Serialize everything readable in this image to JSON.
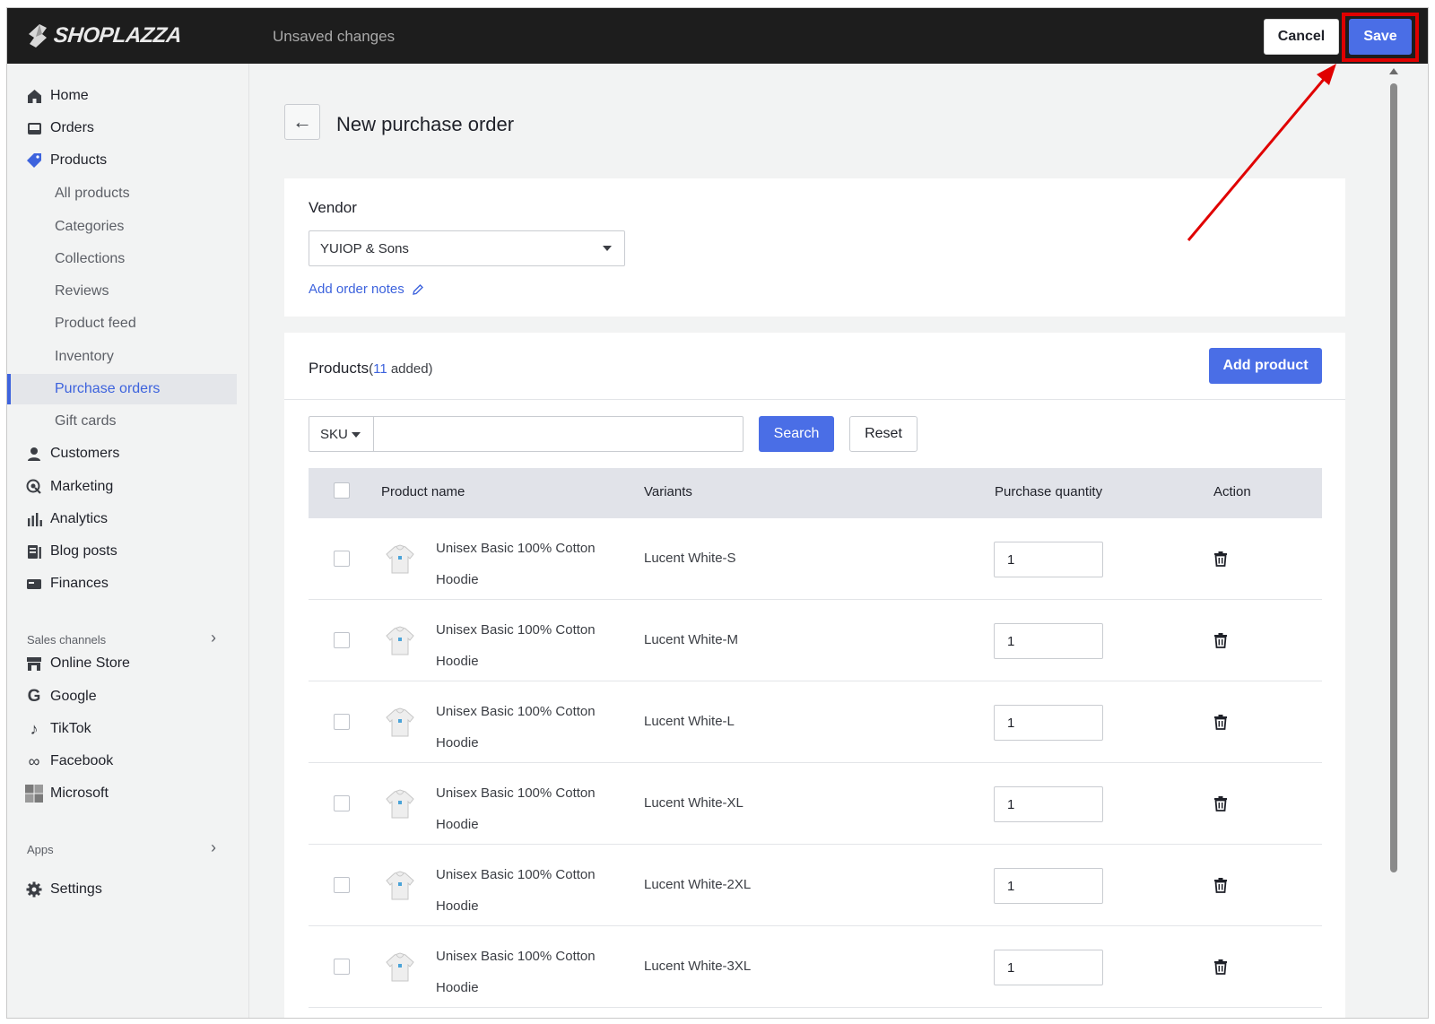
{
  "header": {
    "brand": "SHOPLAZZA",
    "status": "Unsaved changes",
    "cancel_label": "Cancel",
    "save_label": "Save",
    "highlight_color": "#e00000"
  },
  "sidebar": {
    "items": [
      {
        "label": "Home",
        "icon": "home-icon"
      },
      {
        "label": "Orders",
        "icon": "inbox-icon"
      },
      {
        "label": "Products",
        "icon": "tag-icon"
      }
    ],
    "product_subitems": [
      {
        "label": "All products"
      },
      {
        "label": "Categories"
      },
      {
        "label": "Collections"
      },
      {
        "label": "Reviews"
      },
      {
        "label": "Product feed"
      },
      {
        "label": "Inventory"
      },
      {
        "label": "Purchase orders",
        "active": true
      },
      {
        "label": "Gift cards"
      }
    ],
    "more_items": [
      {
        "label": "Customers",
        "icon": "person-icon"
      },
      {
        "label": "Marketing",
        "icon": "marketing-icon"
      },
      {
        "label": "Analytics",
        "icon": "bar-chart-icon"
      },
      {
        "label": "Blog posts",
        "icon": "blog-icon"
      },
      {
        "label": "Finances",
        "icon": "finances-icon"
      }
    ],
    "sales_channels_label": "Sales channels",
    "channels": [
      {
        "label": "Online Store",
        "icon": "store-icon"
      },
      {
        "label": "Google",
        "icon": "google-icon"
      },
      {
        "label": "TikTok",
        "icon": "tiktok-icon"
      },
      {
        "label": "Facebook",
        "icon": "meta-icon"
      },
      {
        "label": "Microsoft",
        "icon": "microsoft-icon"
      }
    ],
    "apps_label": "Apps",
    "settings_label": "Settings"
  },
  "page": {
    "title": "New purchase order",
    "vendor": {
      "title": "Vendor",
      "selected": "YUIOP & Sons",
      "add_notes_label": "Add order notes"
    },
    "products": {
      "title": "Products",
      "count_open": "(",
      "count": "11",
      "count_suffix": " added)",
      "add_button": "Add product",
      "filter_field": "SKU",
      "search_value": "",
      "search_button": "Search",
      "reset_button": "Reset",
      "columns": [
        "Product name",
        "Variants",
        "Purchase quantity",
        "Action"
      ],
      "rows": [
        {
          "name_line1": "Unisex Basic 100% Cotton",
          "name_line2": "Hoodie",
          "variant": "Lucent White-S",
          "quantity": "1"
        },
        {
          "name_line1": "Unisex Basic 100% Cotton",
          "name_line2": "Hoodie",
          "variant": "Lucent White-M",
          "quantity": "1"
        },
        {
          "name_line1": "Unisex Basic 100% Cotton",
          "name_line2": "Hoodie",
          "variant": "Lucent White-L",
          "quantity": "1"
        },
        {
          "name_line1": "Unisex Basic 100% Cotton",
          "name_line2": "Hoodie",
          "variant": "Lucent White-XL",
          "quantity": "1"
        },
        {
          "name_line1": "Unisex Basic 100% Cotton",
          "name_line2": "Hoodie",
          "variant": "Lucent White-2XL",
          "quantity": "1"
        },
        {
          "name_line1": "Unisex Basic 100% Cotton",
          "name_line2": "Hoodie",
          "variant": "Lucent White-3XL",
          "quantity": "1"
        }
      ]
    }
  },
  "colors": {
    "accent": "#4a6ee6",
    "link": "#3d63dd",
    "topbar": "#1d1d1d"
  }
}
